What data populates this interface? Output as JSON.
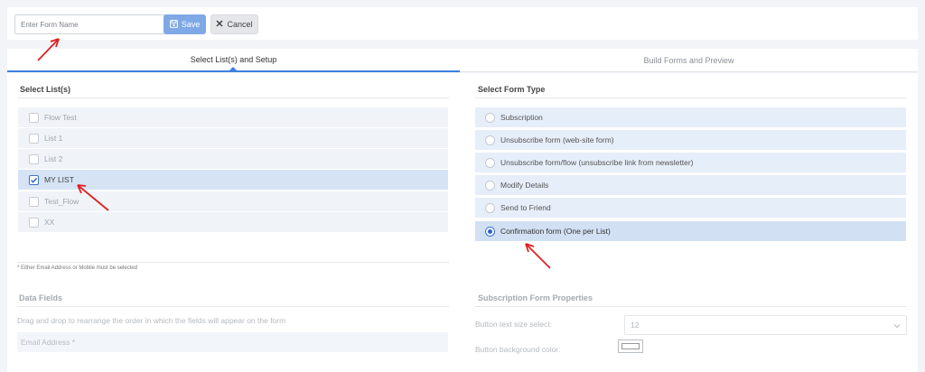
{
  "toolbar": {
    "form_name_placeholder": "Enter Form Name",
    "form_name_value": "",
    "save_label": "Save",
    "cancel_label": "Cancel"
  },
  "tabs": [
    {
      "label": "Select List(s) and Setup",
      "active": true
    },
    {
      "label": "Build Forms and Preview",
      "active": false
    }
  ],
  "lists": {
    "title": "Select List(s)",
    "items": [
      {
        "label": "Flow Test",
        "checked": false
      },
      {
        "label": "List 1",
        "checked": false
      },
      {
        "label": "List 2",
        "checked": false
      },
      {
        "label": "MY LIST",
        "checked": true
      },
      {
        "label": "Test_Flow",
        "checked": false
      },
      {
        "label": "XX",
        "checked": false
      }
    ],
    "note": "* Either Email Address or Mobile must be selected"
  },
  "form_type": {
    "title": "Select Form Type",
    "options": [
      {
        "label": "Subscription",
        "selected": false
      },
      {
        "label": "Unsubscribe form (web-site form)",
        "selected": false
      },
      {
        "label": "Unsubscribe form/flow (unsubscribe link from newsletter)",
        "selected": false
      },
      {
        "label": "Modify Details",
        "selected": false
      },
      {
        "label": "Send to Friend",
        "selected": false
      },
      {
        "label": "Confirmation form (One per List)",
        "selected": true
      }
    ]
  },
  "data_fields": {
    "title": "Data Fields",
    "hint": "Drag and drop to rearrange the order in which the fields will appear on the form",
    "fields": [
      "Email Address *"
    ]
  },
  "properties": {
    "title": "Subscription Form Properties",
    "text_size_label": "Button text size select:",
    "text_size_value": "12",
    "bg_color_label": "Button background color:"
  },
  "colors": {
    "accent": "#3d80e0",
    "save_button": "#7fa9e6",
    "annotation_arrow": "#e02020"
  }
}
